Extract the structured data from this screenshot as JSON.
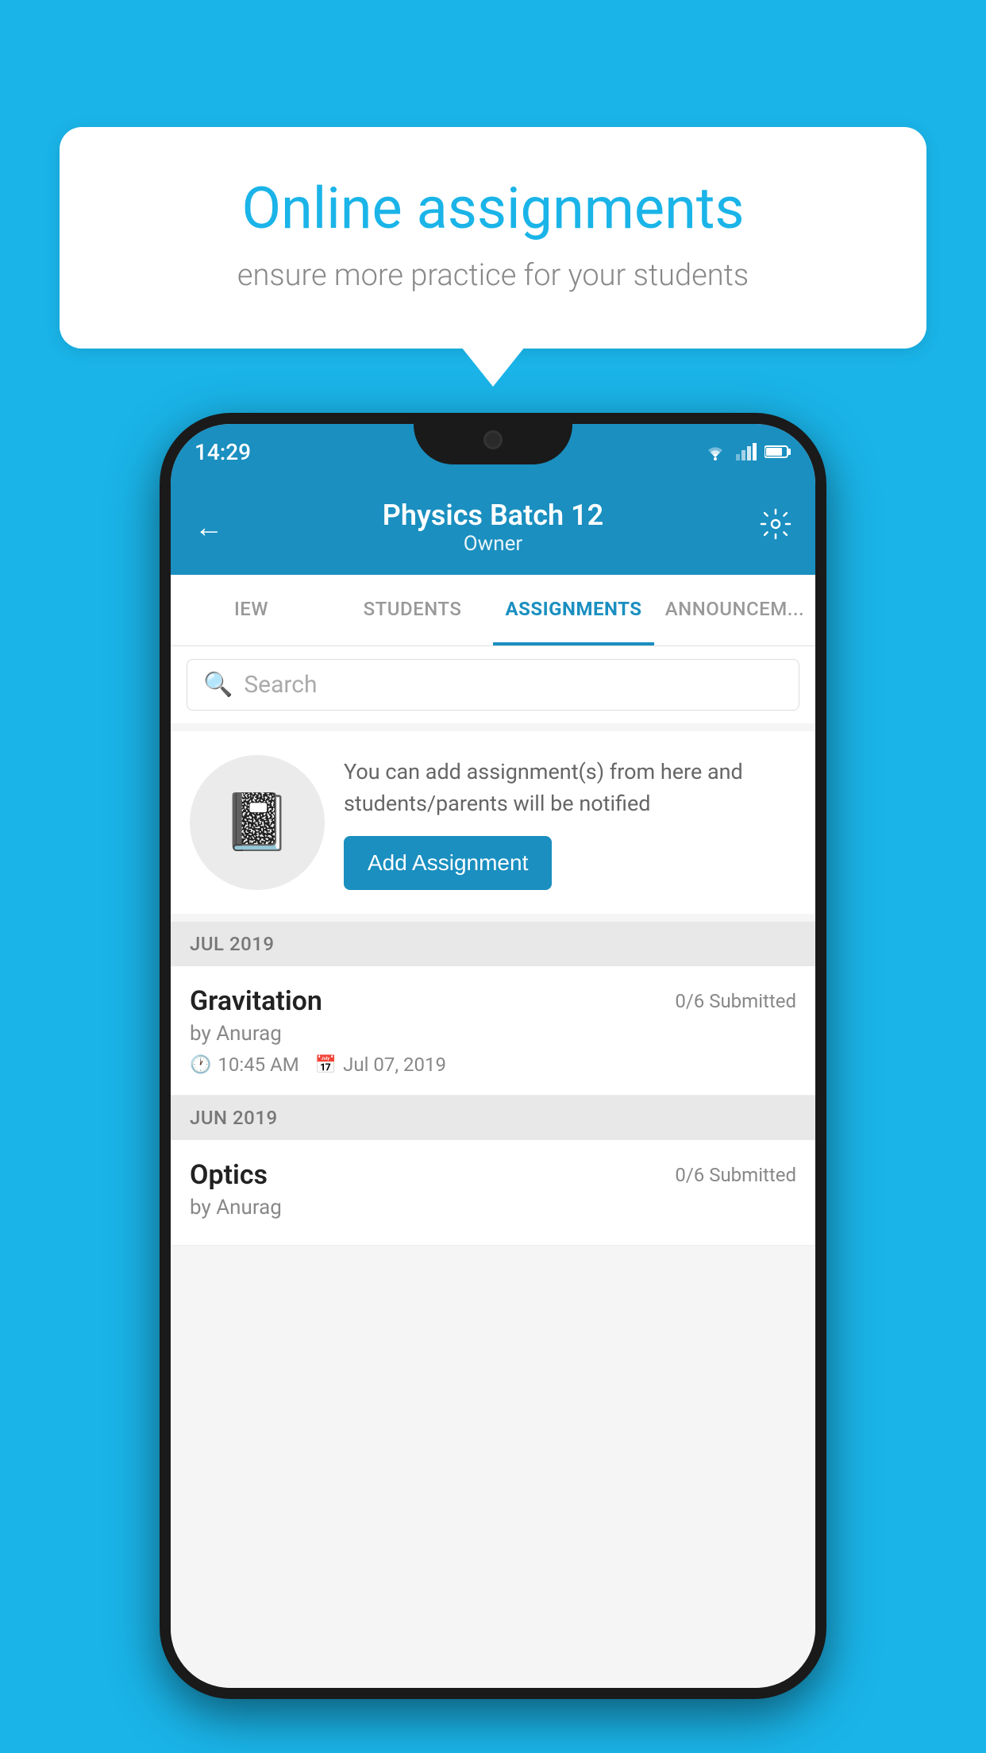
{
  "background_color": "#1ab4e8",
  "speech_bubble": {
    "title": "Online assignments",
    "subtitle": "ensure more practice for your students"
  },
  "phone": {
    "status_bar": {
      "time": "14:29"
    },
    "header": {
      "title": "Physics Batch 12",
      "subtitle": "Owner",
      "back_label": "←",
      "settings_label": "⚙"
    },
    "tabs": [
      {
        "label": "IEW",
        "active": false
      },
      {
        "label": "STUDENTS",
        "active": false
      },
      {
        "label": "ASSIGNMENTS",
        "active": true
      },
      {
        "label": "ANNOUNCEM...",
        "active": false
      }
    ],
    "search": {
      "placeholder": "Search"
    },
    "promo": {
      "description": "You can add assignment(s) from here and students/parents will be notified",
      "button_label": "Add Assignment"
    },
    "sections": [
      {
        "month": "JUL 2019",
        "assignments": [
          {
            "name": "Gravitation",
            "submitted": "0/6 Submitted",
            "by": "by Anurag",
            "time": "10:45 AM",
            "date": "Jul 07, 2019"
          }
        ]
      },
      {
        "month": "JUN 2019",
        "assignments": [
          {
            "name": "Optics",
            "submitted": "0/6 Submitted",
            "by": "by Anurag",
            "time": "",
            "date": ""
          }
        ]
      }
    ]
  }
}
